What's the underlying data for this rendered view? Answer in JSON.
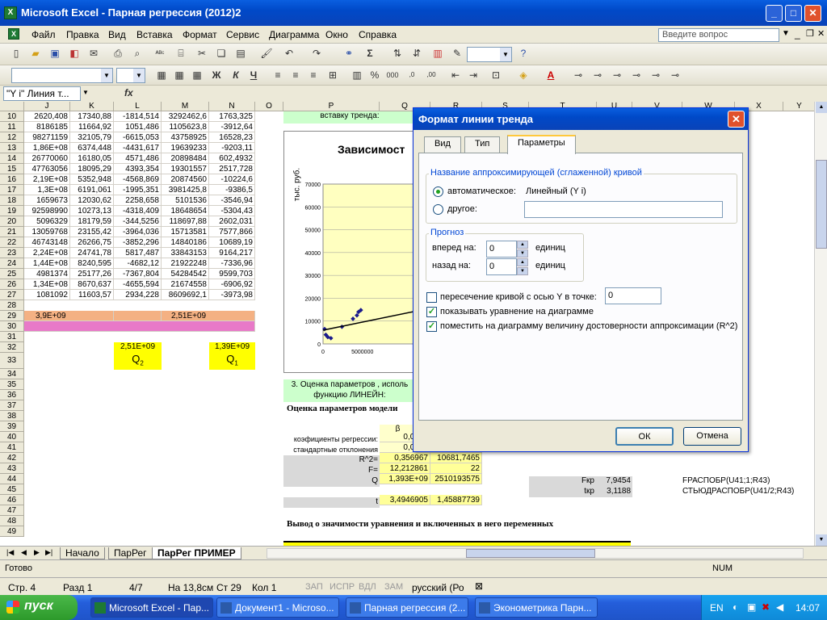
{
  "window": {
    "title": "Microsoft Excel - Парная регрессия (2012)2"
  },
  "menu": [
    "Файл",
    "Правка",
    "Вид",
    "Вставка",
    "Формат",
    "Сервис",
    "Диаграмма",
    "Окно",
    "Справка"
  ],
  "help_placeholder": "Введите вопрос",
  "formula": {
    "namebox": "\"Y i\" Линия т...",
    "fx": "fx"
  },
  "columns": [
    "J",
    "K",
    "L",
    "M",
    "N",
    "O",
    "P",
    "Q",
    "R",
    "S",
    "T",
    "U",
    "V",
    "W",
    "X",
    "Y"
  ],
  "rows": [
    "10",
    "11",
    "12",
    "13",
    "14",
    "15",
    "16",
    "17",
    "18",
    "19",
    "20",
    "21",
    "22",
    "23",
    "24",
    "25",
    "26",
    "27",
    "28",
    "29",
    "30",
    "31",
    "32",
    "33",
    "34",
    "35",
    "36",
    "37",
    "38",
    "39",
    "40",
    "41",
    "42",
    "43",
    "44",
    "45",
    "46",
    "47",
    "48",
    "49"
  ],
  "data_rows": [
    [
      "2620,408",
      "17340,88",
      "-1814,514",
      "3292462,6",
      "1763,325"
    ],
    [
      "8186185",
      "11664,92",
      "1051,486",
      "1105623,8",
      "-3912,64"
    ],
    [
      "98271159",
      "32105,79",
      "-6615,053",
      "43758925",
      "16528,23"
    ],
    [
      "1,86E+08",
      "6374,448",
      "-4431,617",
      "19639233",
      "-9203,11"
    ],
    [
      "26770060",
      "16180,05",
      "4571,486",
      "20898484",
      "602,4932"
    ],
    [
      "47763056",
      "18095,29",
      "4393,354",
      "19301557",
      "2517,728"
    ],
    [
      "2,19E+08",
      "5352,948",
      "-4568,869",
      "20874560",
      "-10224,6"
    ],
    [
      "1,3E+08",
      "6191,061",
      "-1995,351",
      "3981425,8",
      "-9386,5"
    ],
    [
      "1659673",
      "12030,62",
      "2258,658",
      "5101536",
      "-3546,94"
    ],
    [
      "92598990",
      "10273,13",
      "-4318,409",
      "18648654",
      "-5304,43"
    ],
    [
      "5096329",
      "18179,59",
      "-344,5256",
      "118697,88",
      "2602,031"
    ],
    [
      "13059768",
      "23155,42",
      "-3964,036",
      "15713581",
      "7577,866"
    ],
    [
      "46743148",
      "26266,75",
      "-3852,296",
      "14840186",
      "10689,19"
    ],
    [
      "2,24E+08",
      "24741,78",
      "5817,487",
      "33843153",
      "9164,217"
    ],
    [
      "1,44E+08",
      "8240,595",
      "-4682,12",
      "21922248",
      "-7336,96"
    ],
    [
      "4981374",
      "25177,26",
      "-7367,804",
      "54284542",
      "9599,703"
    ],
    [
      "1,34E+08",
      "8670,637",
      "-4655,594",
      "21674558",
      "-6906,92"
    ],
    [
      "1081092",
      "11603,57",
      "2934,228",
      "8609692,1",
      "-3973,98"
    ]
  ],
  "row29": {
    "j": "3,9E+09",
    "m": "2,51E+09"
  },
  "q_cells": {
    "q2_val": "2,51E+09",
    "q2_lbl": "Q",
    "q2_sub": "2",
    "q1_val": "1,39E+09",
    "q1_lbl": "Q",
    "q1_sub": "1"
  },
  "p_col": {
    "trend_text": "вставку тренда:",
    "section3": "3. Оценка параметров , исполь",
    "section3b": "функцию ЛИНЕЙН:",
    "model_heading": "Оценка параметров модели",
    "beta": "β",
    "coef_label": "коэфициенты регрессии:",
    "std_label": "стандартные отклонения",
    "r2_label": "R^2=",
    "f_label": "F=",
    "q_label": "Q",
    "t_label": "t",
    "conclusion": "Вывод о значимости уравнения и включенных в него переменных"
  },
  "q_col": [
    "0,0012",
    "0,0003",
    "0,356967",
    "12,212861",
    "1,393E+09",
    "3,4946905"
  ],
  "r_col": [
    "",
    "",
    "10681,7465",
    "22",
    "2510193575",
    "1,45887739"
  ],
  "fkr": {
    "label": "Fкр",
    "value": "7,9454",
    "formula": "FРАСПОБР(U41;1;R43)"
  },
  "tkr": {
    "label": "tкр",
    "value": "3,1188",
    "formula": "СТЬЮДРАСПОБР(U41/2;R43)"
  },
  "chart": {
    "title": "Зависимост",
    "ylabel": "тыс. руб.",
    "yticks": [
      "70000",
      "60000",
      "50000",
      "40000",
      "30000",
      "20000",
      "10000",
      "0"
    ],
    "xticks": [
      "0",
      "5000000"
    ]
  },
  "chart_data": {
    "type": "scatter",
    "title": "Зависимост",
    "ylabel": "тыс. руб.",
    "ylim": [
      0,
      70000
    ],
    "points_visible": [
      [
        200000,
        6500
      ],
      [
        350000,
        4000
      ],
      [
        600000,
        3000
      ],
      [
        1000000,
        2500
      ],
      [
        2400000,
        7500
      ],
      [
        3800000,
        11000
      ],
      [
        4300000,
        12500
      ],
      [
        4500000,
        14000
      ],
      [
        4800000,
        14800
      ]
    ],
    "trendline": "linear"
  },
  "dialog": {
    "title": "Формат линии тренда",
    "tabs": [
      "Вид",
      "Тип",
      "Параметры"
    ],
    "group1": "Название аппроксимирующей (сглаженной) кривой",
    "auto_label": "автоматическое:",
    "auto_value": "Линейный (Y i)",
    "other_label": "другое:",
    "group2": "Прогноз",
    "forward_label": "вперед на:",
    "forward_value": "0",
    "back_label": "назад на:",
    "back_value": "0",
    "units": "единиц",
    "intercept_label": "пересечение кривой с осью Y в точке:",
    "intercept_value": "0",
    "show_eq": "показывать уравнение на диаграмме",
    "show_r2": "поместить на диаграмму величину достоверности аппроксимации (R^2)",
    "ok": "ОК",
    "cancel": "Отмена"
  },
  "sheet_tabs": [
    "Начало",
    "ПарРег",
    "ПарРег ПРИМЕР"
  ],
  "status": {
    "ready": "Готово",
    "num": "NUM"
  },
  "wordstatus": {
    "page": "Стр. 4",
    "section": "Разд 1",
    "pages": "4/7",
    "at": "На 13,8см",
    "line": "Ст 29",
    "col": "Кол 1",
    "rec": "ЗАП",
    "trk": "ИСПР",
    "ext": "ВДЛ",
    "ovr": "ЗАМ",
    "lang": "русский (Ро"
  },
  "taskbar": {
    "start": "пуск",
    "tasks": [
      "Microsoft Excel - Пар...",
      "Документ1 - Microso...",
      "Парная регрессия (2...",
      "Эконометрика Парн..."
    ],
    "lang": "EN",
    "clock": "14:07"
  }
}
